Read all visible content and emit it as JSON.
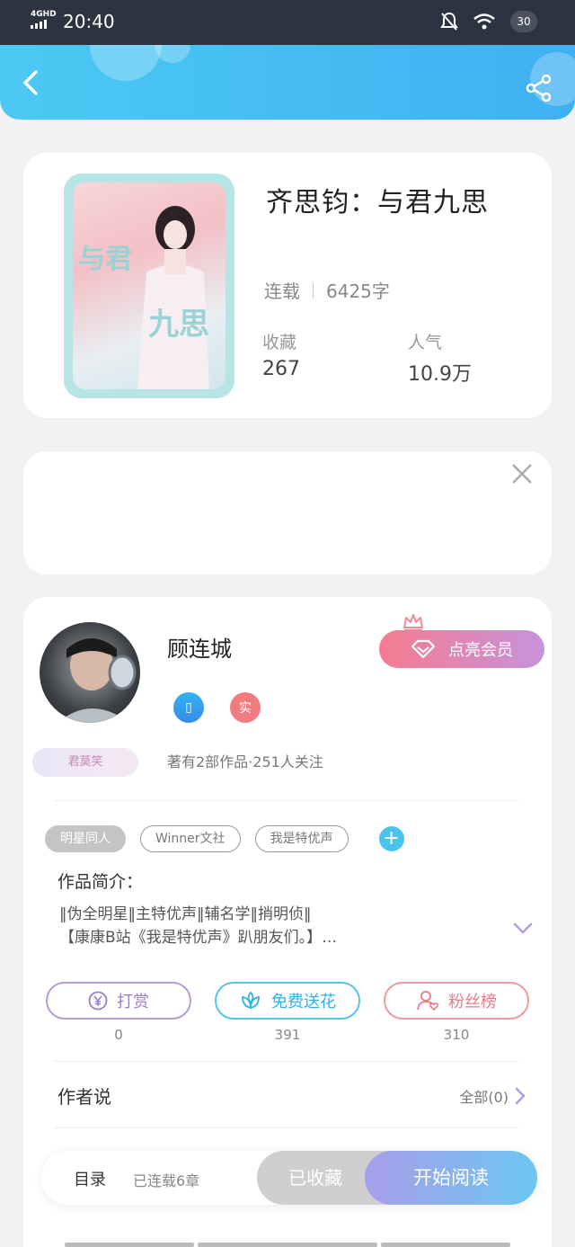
{
  "status_bar": {
    "network": "4GHD",
    "time": "20:40",
    "battery": "30"
  },
  "colors": {
    "header": "#3fb0f2",
    "vip": "#f57b8f",
    "read_button": "#a79ee9",
    "tag_add": "#4cc3ef"
  },
  "book": {
    "cover_text_1": "与君",
    "cover_text_2": "九思",
    "title": "齐思钧：与君九思",
    "status": "连载",
    "word_count": "6425字",
    "favorites_label": "收藏",
    "favorites_value": "267",
    "popularity_label": "人气",
    "popularity_value": "10.9万"
  },
  "author": {
    "name": "顾连城",
    "badge_phone": "▯",
    "badge_real": "实",
    "vip_button": "点亮会员",
    "level_badge": "君莫笑",
    "stats": "著有2部作品·251人关注",
    "tags": [
      "明星同人",
      "Winner文社",
      "我是特优声"
    ],
    "tag_add": "+",
    "intro_title": "作品简介：",
    "intro_line1": "‖伪全明星‖主特优声‖辅名学‖捎明侦‖",
    "intro_line2": "【康康B站《我是特优声》趴朋友们。】…",
    "actions": [
      {
        "label": "打赏",
        "count": "0",
        "icon": "yen-icon"
      },
      {
        "label": "免费送花",
        "count": "391",
        "icon": "flower-icon"
      },
      {
        "label": "粉丝榜",
        "count": "310",
        "icon": "fans-icon"
      }
    ],
    "author_says": "作者说",
    "author_says_more": "全部(0)"
  },
  "bottom_bar": {
    "toc": "目录",
    "toc_sub": "已连载6章",
    "collected": "已收藏",
    "start_reading": "开始阅读"
  }
}
